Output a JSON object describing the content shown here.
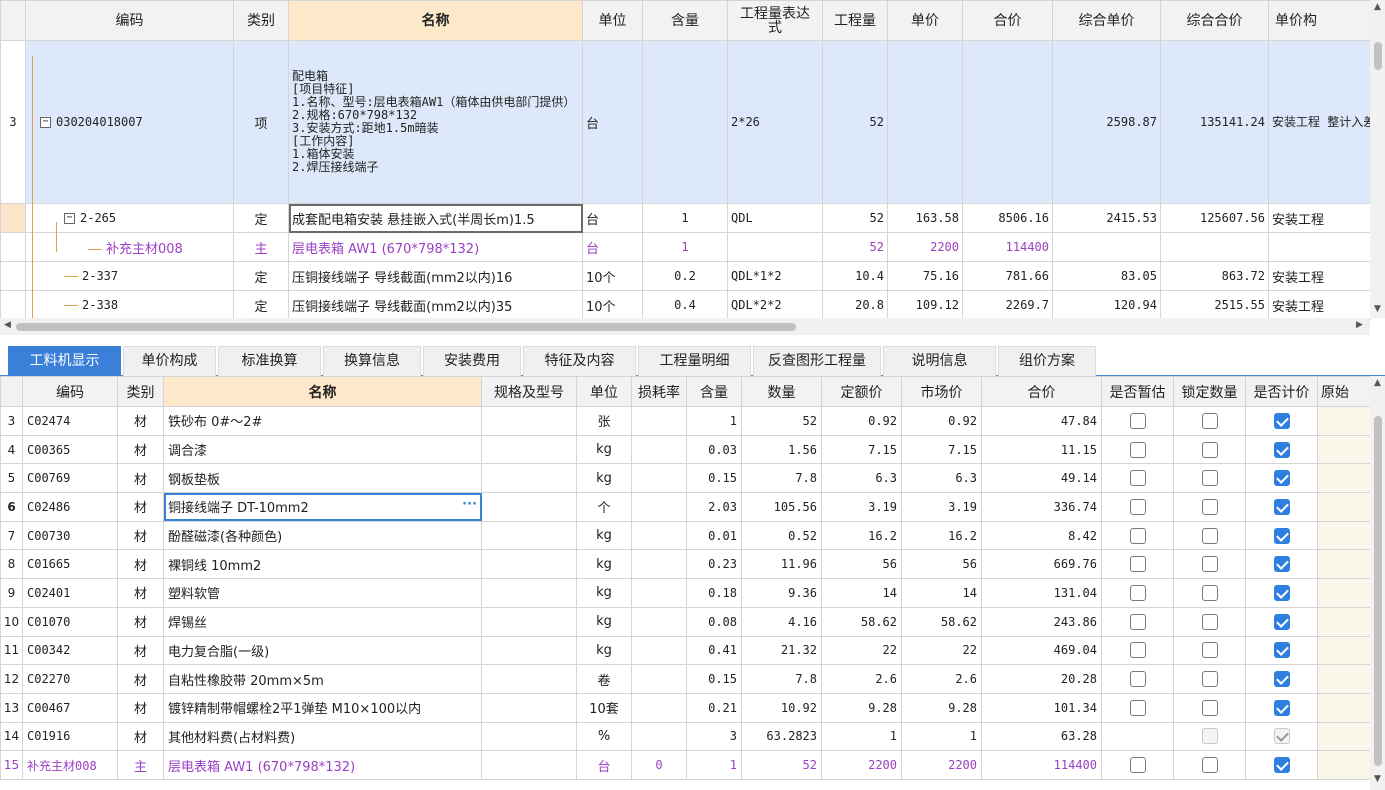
{
  "top": {
    "headers": [
      "编码",
      "类别",
      "名称",
      "单位",
      "含量",
      "工程量表达式",
      "工程量",
      "单价",
      "合价",
      "综合单价",
      "综合合价",
      "单价构"
    ],
    "rows": [
      {
        "rownum": "3",
        "code": "030204018007",
        "cat": "项",
        "name_lines": [
          "配电箱",
          "[项目特征]",
          "1.名称、型号:层电表箱AW1（箱体由供电部门提供）",
          "2.规格:670*798*132",
          "3.安装方式:距地1.5m暗装",
          "[工作内容]",
          "1.箱体安装",
          "2.焊压接线端子"
        ],
        "unit": "台",
        "qty": "",
        "expr": "2*26",
        "amount": "52",
        "price": "",
        "total": "",
        "comp_price": "2598.87",
        "comp_total": "135141.24",
        "price_struct": "安装工程 整计入差"
      },
      {
        "rownum": "",
        "code": "2-265",
        "cat": "定",
        "name": "成套配电箱安装 悬挂嵌入式(半周长m)1.5",
        "unit": "台",
        "qty": "1",
        "expr": "QDL",
        "amount": "52",
        "price": "163.58",
        "total": "8506.16",
        "comp_price": "2415.53",
        "comp_total": "125607.56",
        "price_struct": "安装工程"
      },
      {
        "rownum": "",
        "code": "补充主材008",
        "cat": "主",
        "name": "层电表箱 AW1 (670*798*132)",
        "unit": "台",
        "qty": "1",
        "expr": "",
        "amount": "52",
        "price": "2200",
        "total": "114400",
        "comp_price": "",
        "comp_total": "",
        "price_struct": ""
      },
      {
        "rownum": "",
        "code": "2-337",
        "cat": "定",
        "name": "压铜接线端子 导线截面(mm2以内)16",
        "unit": "10个",
        "qty": "0.2",
        "expr": "QDL*1*2",
        "amount": "10.4",
        "price": "75.16",
        "total": "781.66",
        "comp_price": "83.05",
        "comp_total": "863.72",
        "price_struct": "安装工程"
      },
      {
        "rownum": "",
        "code": "2-338",
        "cat": "定",
        "name": "压铜接线端子 导线截面(mm2以内)35",
        "unit": "10个",
        "qty": "0.4",
        "expr": "QDL*2*2",
        "amount": "20.8",
        "price": "109.12",
        "total": "2269.7",
        "comp_price": "120.94",
        "comp_total": "2515.55",
        "price_struct": "安装工程"
      }
    ]
  },
  "tabs": [
    "工料机显示",
    "单价构成",
    "标准换算",
    "换算信息",
    "安装费用",
    "特征及内容",
    "工程量明细",
    "反查图形工程量",
    "说明信息",
    "组价方案"
  ],
  "bottom": {
    "headers": [
      "编码",
      "类别",
      "名称",
      "规格及型号",
      "单位",
      "损耗率",
      "含量",
      "数量",
      "定额价",
      "市场价",
      "合价",
      "是否暂估",
      "锁定数量",
      "是否计价",
      "原始"
    ],
    "rows": [
      {
        "n": "3",
        "code": "C02474",
        "cat": "材",
        "name": "铁砂布 0#～2#",
        "spec": "",
        "unit": "张",
        "loss": "",
        "qty": "1",
        "count": "52",
        "quota": "0.92",
        "market": "0.92",
        "total": "47.84",
        "est": false,
        "lock": false,
        "priced": true
      },
      {
        "n": "4",
        "code": "C00365",
        "cat": "材",
        "name": "调合漆",
        "spec": "",
        "unit": "kg",
        "loss": "",
        "qty": "0.03",
        "count": "1.56",
        "quota": "7.15",
        "market": "7.15",
        "total": "11.15",
        "est": false,
        "lock": false,
        "priced": true
      },
      {
        "n": "5",
        "code": "C00769",
        "cat": "材",
        "name": "钢板垫板",
        "spec": "",
        "unit": "kg",
        "loss": "",
        "qty": "0.15",
        "count": "7.8",
        "quota": "6.3",
        "market": "6.3",
        "total": "49.14",
        "est": false,
        "lock": false,
        "priced": true
      },
      {
        "n": "6",
        "code": "C02486",
        "cat": "材",
        "name": "铜接线端子 DT-10mm2",
        "spec": "",
        "unit": "个",
        "loss": "",
        "qty": "2.03",
        "count": "105.56",
        "quota": "3.19",
        "market": "3.19",
        "total": "336.74",
        "est": false,
        "lock": false,
        "priced": true
      },
      {
        "n": "7",
        "code": "C00730",
        "cat": "材",
        "name": "酚醛磁漆(各种颜色)",
        "spec": "",
        "unit": "kg",
        "loss": "",
        "qty": "0.01",
        "count": "0.52",
        "quota": "16.2",
        "market": "16.2",
        "total": "8.42",
        "est": false,
        "lock": false,
        "priced": true
      },
      {
        "n": "8",
        "code": "C01665",
        "cat": "材",
        "name": "裸铜线 10mm2",
        "spec": "",
        "unit": "kg",
        "loss": "",
        "qty": "0.23",
        "count": "11.96",
        "quota": "56",
        "market": "56",
        "total": "669.76",
        "est": false,
        "lock": false,
        "priced": true
      },
      {
        "n": "9",
        "code": "C02401",
        "cat": "材",
        "name": "塑料软管",
        "spec": "",
        "unit": "kg",
        "loss": "",
        "qty": "0.18",
        "count": "9.36",
        "quota": "14",
        "market": "14",
        "total": "131.04",
        "est": false,
        "lock": false,
        "priced": true
      },
      {
        "n": "10",
        "code": "C01070",
        "cat": "材",
        "name": "焊锡丝",
        "spec": "",
        "unit": "kg",
        "loss": "",
        "qty": "0.08",
        "count": "4.16",
        "quota": "58.62",
        "market": "58.62",
        "total": "243.86",
        "est": false,
        "lock": false,
        "priced": true
      },
      {
        "n": "11",
        "code": "C00342",
        "cat": "材",
        "name": "电力复合脂(一级)",
        "spec": "",
        "unit": "kg",
        "loss": "",
        "qty": "0.41",
        "count": "21.32",
        "quota": "22",
        "market": "22",
        "total": "469.04",
        "est": false,
        "lock": false,
        "priced": true
      },
      {
        "n": "12",
        "code": "C02270",
        "cat": "材",
        "name": "自粘性橡胶带 20mm×5m",
        "spec": "",
        "unit": "卷",
        "loss": "",
        "qty": "0.15",
        "count": "7.8",
        "quota": "2.6",
        "market": "2.6",
        "total": "20.28",
        "est": false,
        "lock": false,
        "priced": true
      },
      {
        "n": "13",
        "code": "C00467",
        "cat": "材",
        "name": "镀锌精制带帽螺栓2平1弹垫 M10×100以内",
        "spec": "",
        "unit": "10套",
        "loss": "",
        "qty": "0.21",
        "count": "10.92",
        "quota": "9.28",
        "market": "9.28",
        "total": "101.34",
        "est": false,
        "lock": false,
        "priced": true
      },
      {
        "n": "14",
        "code": "C01916",
        "cat": "材",
        "name": "其他材料费(占材料费)",
        "spec": "",
        "unit": "%",
        "loss": "",
        "qty": "3",
        "count": "63.2823",
        "quota": "1",
        "market": "1",
        "total": "63.28",
        "est": null,
        "lock": false,
        "priced": true,
        "disabled": true
      },
      {
        "n": "15",
        "code": "补充主材008",
        "cat": "主",
        "name": "层电表箱 AW1 (670*798*132)",
        "spec": "",
        "unit": "台",
        "loss": "0",
        "qty": "1",
        "count": "52",
        "quota": "2200",
        "market": "2200",
        "total": "114400",
        "est": false,
        "lock": false,
        "priced": true,
        "purple": true
      }
    ],
    "edit_dots": "···"
  }
}
